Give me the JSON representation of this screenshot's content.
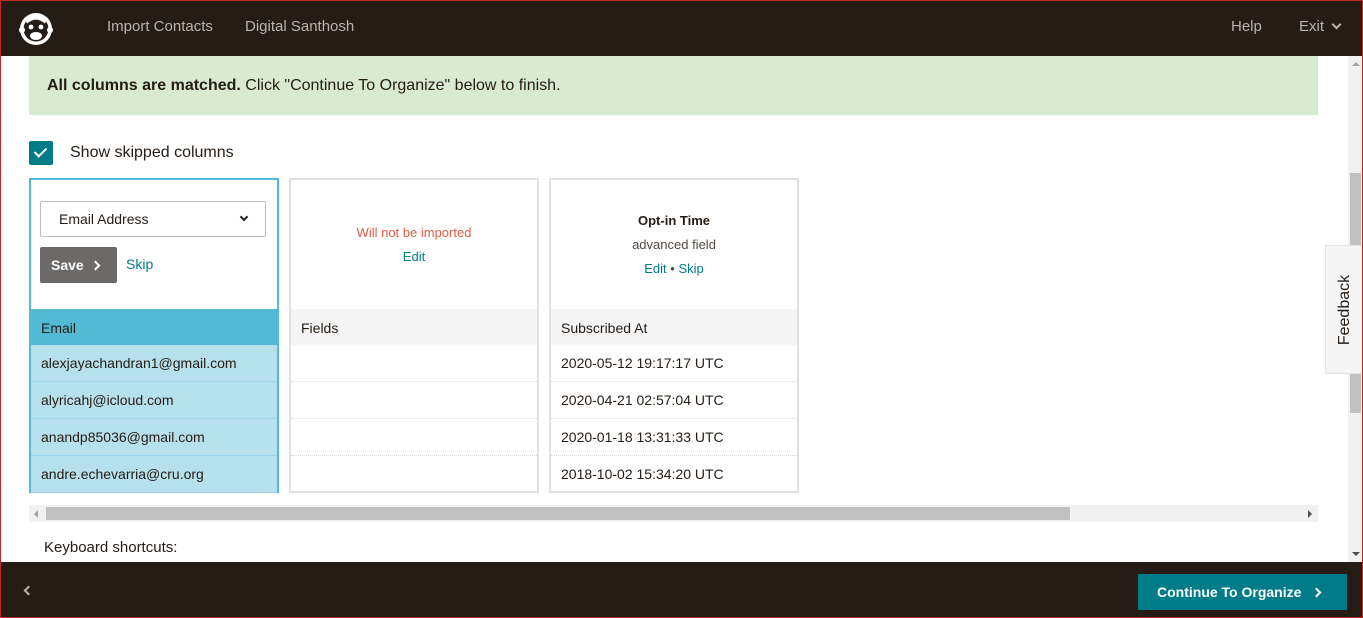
{
  "header": {
    "nav": [
      "Import Contacts",
      "Digital Santhosh"
    ],
    "help_label": "Help",
    "exit_label": "Exit"
  },
  "banner": {
    "bold_text": "All columns are matched.",
    "text": " Click \"Continue To Organize\" below to finish."
  },
  "show_skipped": {
    "label": "Show skipped columns",
    "checked": true
  },
  "columns": [
    {
      "select_value": "Email Address",
      "save_label": "Save",
      "skip_label": "Skip",
      "header": "Email",
      "rows": [
        "alexjayachandran1@gmail.com",
        "alyricahj@icloud.com",
        "anandp85036@gmail.com",
        "andre.echevarria@cru.org"
      ]
    },
    {
      "status": "Will not be imported",
      "edit_label": "Edit",
      "header": "Fields",
      "rows": [
        "",
        "",
        "",
        ""
      ]
    },
    {
      "title": "Opt-in Time",
      "subtitle": "advanced field",
      "edit_label": "Edit",
      "separator": "•",
      "skip_label": "Skip",
      "header": "Subscribed At",
      "rows": [
        "2020-05-12 19:17:17 UTC",
        "2020-04-21 02:57:04 UTC",
        "2020-01-18 13:31:33 UTC",
        "2018-10-02 15:34:20 UTC"
      ]
    }
  ],
  "keyboard_shortcuts_label": "Keyboard shortcuts:",
  "feedback_label": "Feedback",
  "footer": {
    "continue_label": "Continue To Organize"
  },
  "colors": {
    "topbar": "#241c15",
    "accent": "#007c89",
    "banner": "#d8ebd0",
    "active_column": "#52bad5",
    "warning": "#e25b45"
  },
  "icons": [
    "freddie-logo-icon",
    "chevron-down-icon",
    "checkmark-icon",
    "chevron-right-icon",
    "chevron-left-icon"
  ]
}
